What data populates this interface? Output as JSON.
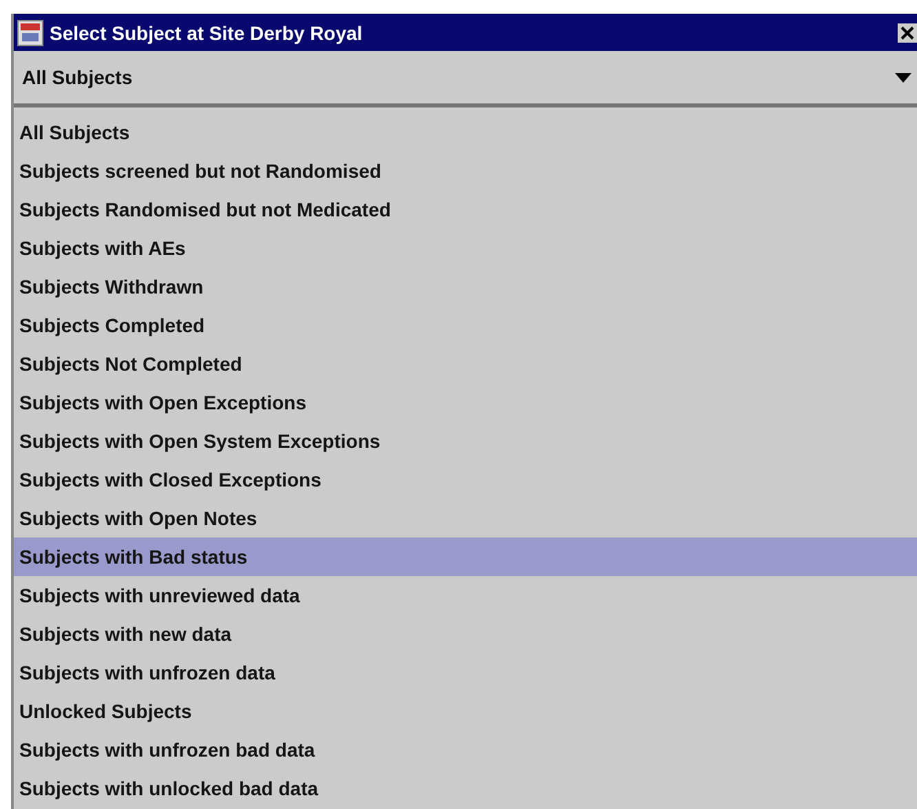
{
  "window": {
    "title": "Select Subject at Site Derby Royal"
  },
  "filter": {
    "value": "All Subjects"
  },
  "list": {
    "items": [
      {
        "label": "All Subjects",
        "selected": false
      },
      {
        "label": "Subjects screened but not Randomised",
        "selected": false
      },
      {
        "label": "Subjects Randomised but not Medicated",
        "selected": false
      },
      {
        "label": "Subjects with AEs",
        "selected": false
      },
      {
        "label": "Subjects Withdrawn",
        "selected": false
      },
      {
        "label": "Subjects Completed",
        "selected": false
      },
      {
        "label": "Subjects Not Completed",
        "selected": false
      },
      {
        "label": "Subjects with Open Exceptions",
        "selected": false
      },
      {
        "label": "Subjects with Open System Exceptions",
        "selected": false
      },
      {
        "label": "Subjects with Closed Exceptions",
        "selected": false
      },
      {
        "label": "Subjects with Open Notes",
        "selected": false
      },
      {
        "label": "Subjects with Bad status",
        "selected": true
      },
      {
        "label": "Subjects with unreviewed data",
        "selected": false
      },
      {
        "label": "Subjects with new data",
        "selected": false
      },
      {
        "label": "Subjects with unfrozen data",
        "selected": false
      },
      {
        "label": "Unlocked Subjects",
        "selected": false
      },
      {
        "label": "Subjects with unfrozen bad data",
        "selected": false
      },
      {
        "label": "Subjects with unlocked bad data",
        "selected": false
      }
    ]
  }
}
